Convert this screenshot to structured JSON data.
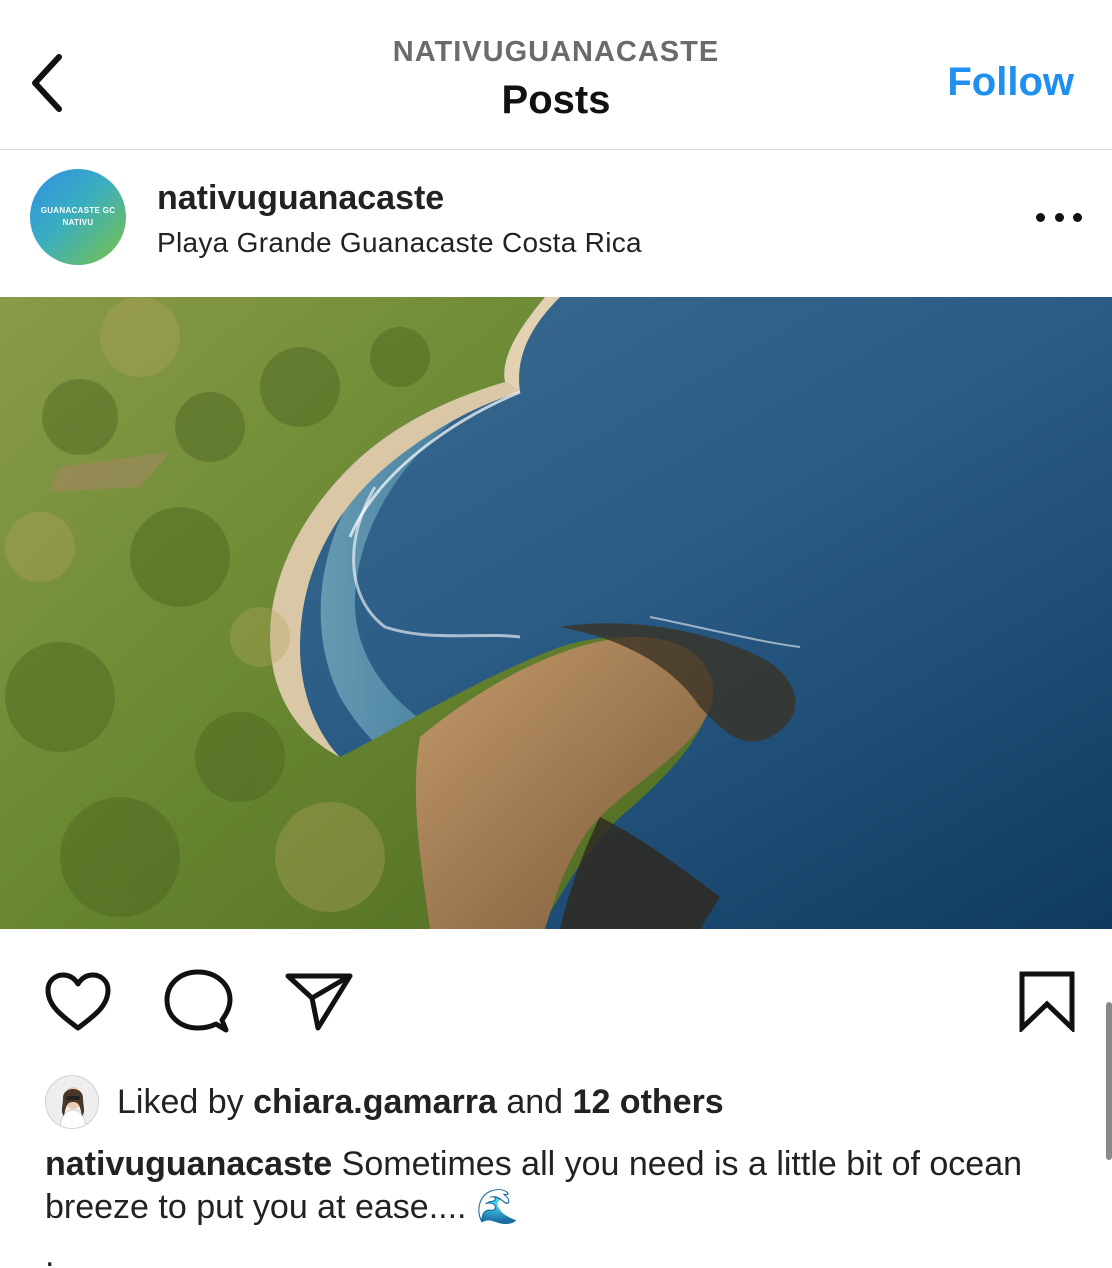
{
  "header": {
    "account": "NATIVUGUANACASTE",
    "title": "Posts",
    "follow_label": "Follow",
    "back_icon": "chevron-left-icon"
  },
  "post": {
    "username": "nativuguanacaste",
    "location": "Playa Grande Guanacaste Costa Rica",
    "avatar_text": [
      "GUANACASTE GC",
      "NATIVU"
    ],
    "more_icon": "more-horizontal-icon"
  },
  "actions": {
    "like_icon": "heart-icon",
    "comment_icon": "comment-icon",
    "share_icon": "send-icon",
    "save_icon": "bookmark-icon"
  },
  "likes": {
    "prefix": "Liked by ",
    "user": "chiara.gamarra",
    "middle": " and ",
    "others": "12 others"
  },
  "caption": {
    "username": "nativuguanacaste",
    "text": " Sometimes all you need is a little bit of ocean breeze to put you at ease.... 🌊",
    "dot": "."
  },
  "colors": {
    "accent": "#1f8ff0",
    "text": "#111111",
    "muted": "#6b6b6b"
  }
}
